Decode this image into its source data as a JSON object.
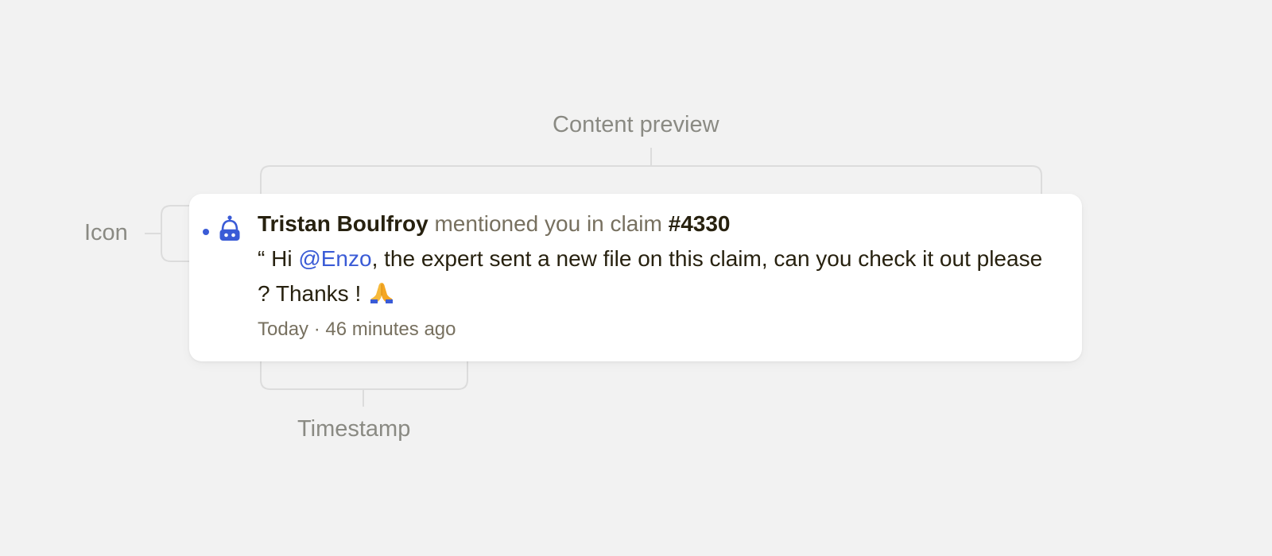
{
  "annotations": {
    "content_preview": "Content preview",
    "icon": "Icon",
    "timestamp": "Timestamp"
  },
  "notification": {
    "unread": true,
    "icon": "robot-bell-icon",
    "author": "Tristan Boulfroy",
    "action": "mentioned you in claim",
    "reference": "#4330",
    "preview_open_quote": "“ Hi ",
    "preview_mention": "@Enzo",
    "preview_rest": ", the expert sent a new file on this claim, can you check it out please ? Thanks ! ",
    "preview_emoji": "folded-hands-icon",
    "timestamp": "Today · 46 minutes ago"
  },
  "colors": {
    "background": "#f2f2f2",
    "card": "#ffffff",
    "accent": "#3a5bd6",
    "text_primary": "#27210f",
    "text_secondary": "#77705f",
    "annotation": "#8a8a83",
    "bracket": "#dcdcdc"
  }
}
